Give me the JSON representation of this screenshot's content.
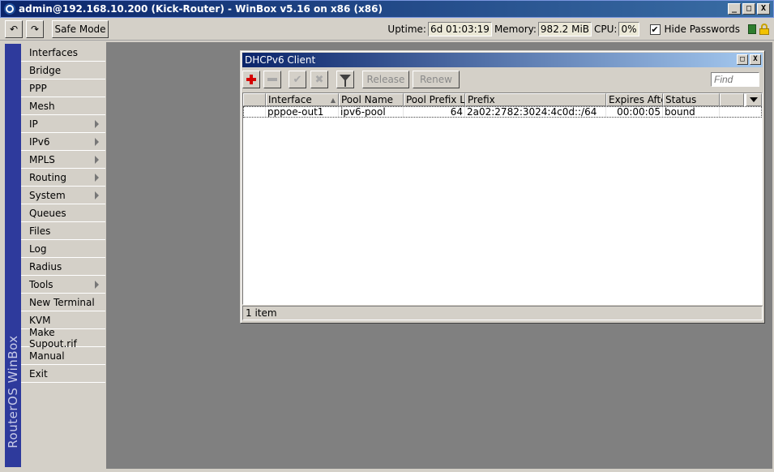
{
  "window": {
    "title": "admin@192.168.10.200 (Kick-Router) - WinBox v5.16 on x86 (x86)",
    "minimize": "_",
    "maximize": "□",
    "close": "X"
  },
  "toolbar": {
    "undo_icon": "↶",
    "redo_icon": "↷",
    "safe_mode": "Safe Mode",
    "uptime_label": "Uptime:",
    "uptime_value": "6d 01:03:19",
    "memory_label": "Memory:",
    "memory_value": "982.2 MiB",
    "cpu_label": "CPU:",
    "cpu_value": "0%",
    "hide_passwords_label": "Hide Passwords",
    "hide_passwords_checked": "✔"
  },
  "brand": "RouterOS WinBox",
  "menu": [
    {
      "label": "Interfaces"
    },
    {
      "label": "Bridge"
    },
    {
      "label": "PPP"
    },
    {
      "label": "Mesh"
    },
    {
      "label": "IP"
    },
    {
      "label": "IPv6"
    },
    {
      "label": "MPLS"
    },
    {
      "label": "Routing"
    },
    {
      "label": "System"
    },
    {
      "label": "Queues"
    },
    {
      "label": "Files"
    },
    {
      "label": "Log"
    },
    {
      "label": "Radius"
    },
    {
      "label": "Tools"
    },
    {
      "label": "New Terminal"
    },
    {
      "label": "KVM"
    },
    {
      "label": "Make Supout.rif"
    },
    {
      "label": "Manual"
    },
    {
      "label": "Exit"
    }
  ],
  "dhcp_window": {
    "title": "DHCPv6 Client",
    "maximize": "□",
    "close": "X",
    "buttons": {
      "check": "✔",
      "x": "✖",
      "release": "Release",
      "renew": "Renew"
    },
    "find_placeholder": "Find",
    "columns": [
      "",
      "Interface",
      "Pool Name",
      "Pool Prefix L...",
      "Prefix",
      "Expires After",
      "Status"
    ],
    "sort_indicator": "▲",
    "rows": [
      {
        "flag": "",
        "interface": "pppoe-out1",
        "pool_name": "ipv6-pool",
        "pool_prefix_length": "64",
        "prefix": "2a02:2782:3024:4c0d::/64",
        "expires_after": "00:00:05",
        "status": "bound"
      }
    ],
    "status": "1 item"
  },
  "colors": {
    "title_gradient_start": "#0a246a",
    "brand_strip": "#2e3a9c",
    "workspace": "#808080",
    "add_button": "#d40000"
  }
}
